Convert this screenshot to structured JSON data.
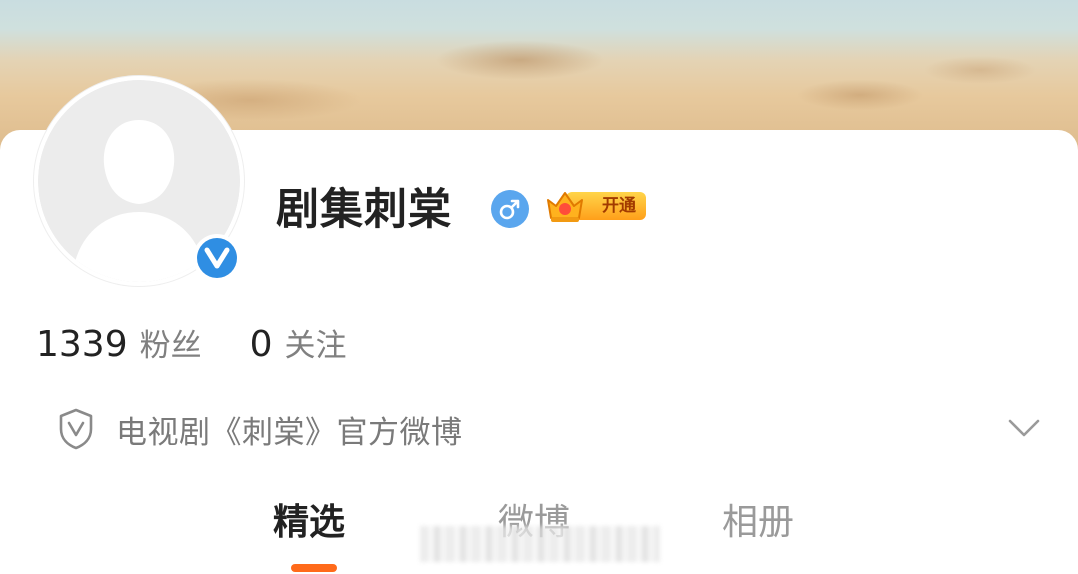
{
  "profile": {
    "name": "剧集刺棠",
    "gender_icon": "male-icon",
    "vip_label": "开通",
    "verified_icon": "verified-v-icon",
    "colors": {
      "accent": "#ff6a1a",
      "verify_blue": "#2f8ee3",
      "gender_blue": "#5aa6ee",
      "vip_gold": "#ffb21e"
    }
  },
  "stats": {
    "followers_count": "1339",
    "followers_label": "粉丝",
    "following_count": "0",
    "following_label": "关注"
  },
  "verification": {
    "icon": "shield-v-icon",
    "text": "电视剧《刺棠》官方微博",
    "expand_icon": "chevron-down-icon"
  },
  "tabs": [
    {
      "label": "精选",
      "active": true
    },
    {
      "label": "微博",
      "active": false
    },
    {
      "label": "相册",
      "active": false
    }
  ]
}
